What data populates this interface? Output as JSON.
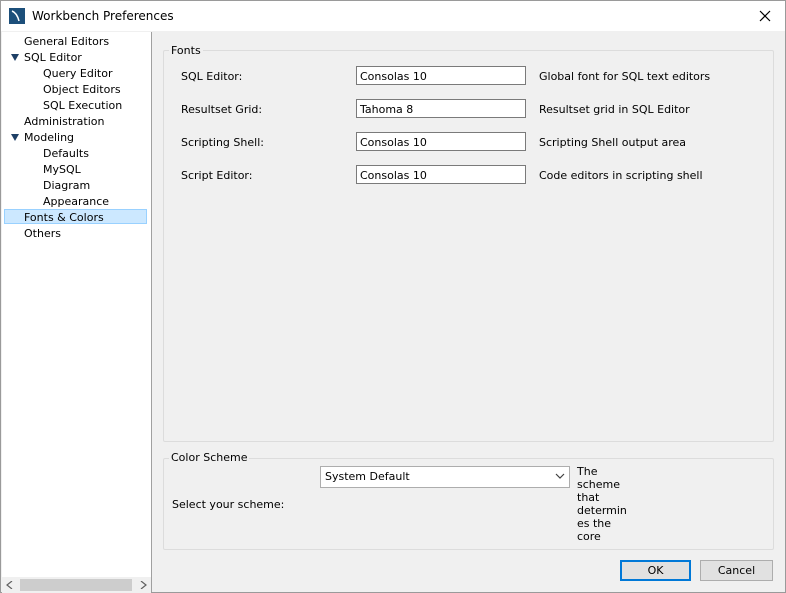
{
  "window": {
    "title": "Workbench Preferences"
  },
  "icons": {
    "app": "mysql-workbench-icon",
    "close": "close-icon"
  },
  "sidebar": {
    "items": [
      {
        "label": "General Editors"
      },
      {
        "label": "SQL Editor"
      },
      {
        "label": "Query Editor"
      },
      {
        "label": "Object Editors"
      },
      {
        "label": "SQL Execution"
      },
      {
        "label": "Administration"
      },
      {
        "label": "Modeling"
      },
      {
        "label": "Defaults"
      },
      {
        "label": "MySQL"
      },
      {
        "label": "Diagram"
      },
      {
        "label": "Appearance"
      },
      {
        "label": "Fonts & Colors"
      },
      {
        "label": "Others"
      }
    ],
    "selected": "Fonts & Colors"
  },
  "fonts": {
    "title": "Fonts",
    "rows": [
      {
        "label": "SQL Editor:",
        "value": "Consolas 10",
        "desc": "Global font for SQL text editors"
      },
      {
        "label": "Resultset Grid:",
        "value": "Tahoma 8",
        "desc": "Resultset grid in SQL Editor"
      },
      {
        "label": "Scripting Shell:",
        "value": "Consolas 10",
        "desc": "Scripting Shell output area"
      },
      {
        "label": "Script Editor:",
        "value": "Consolas 10",
        "desc": "Code editors in scripting shell"
      }
    ]
  },
  "color_scheme": {
    "title": "Color Scheme",
    "label": "Select your scheme:",
    "selected": "System Default",
    "description": "The scheme that determines the core"
  },
  "buttons": {
    "ok": "OK",
    "cancel": "Cancel"
  },
  "colors": {
    "selection": "#cce8ff",
    "accent": "#0078d7"
  }
}
